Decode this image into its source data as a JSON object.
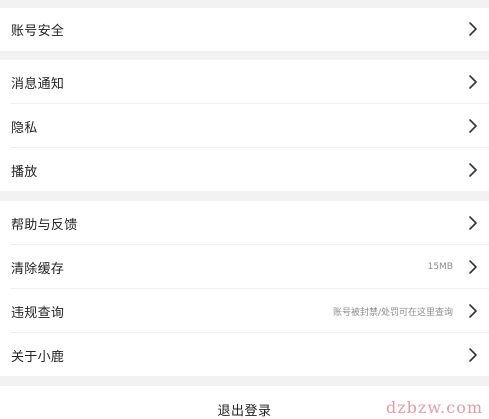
{
  "settings": {
    "account_security": "账号安全",
    "notifications": "消息通知",
    "privacy": "隐私",
    "playback": "播放",
    "help_feedback": "帮助与反馈",
    "clear_cache": "清除缓存",
    "cache_size": "15MB",
    "violation_query": "违规查询",
    "violation_hint": "账号被封禁/处罚可在这里查询",
    "about": "关于小鹿"
  },
  "logout_label": "退出登录",
  "watermark": "dzbzw.com",
  "icons": {
    "chevron": "chevron-right-icon"
  }
}
